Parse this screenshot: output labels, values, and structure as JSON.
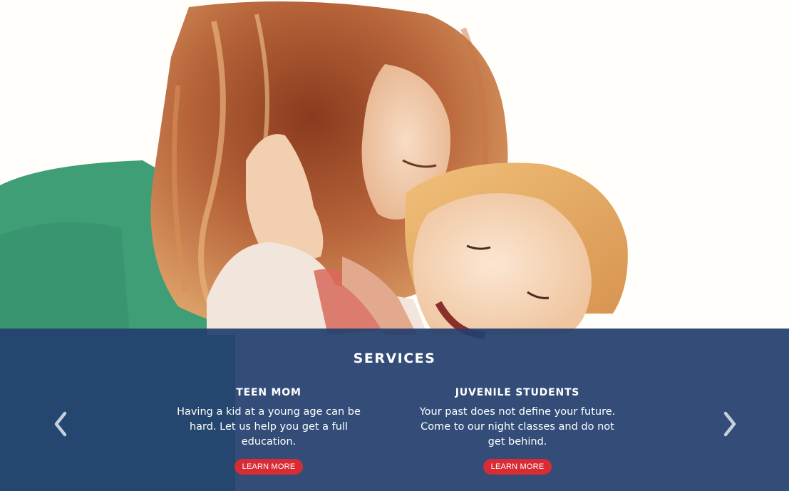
{
  "services": {
    "title": "SERVICES",
    "items": [
      {
        "title": "TEEN MOM",
        "text": "Having a kid at a young age can be hard. Let us help you get a full education.",
        "button": "LEARN MORE"
      },
      {
        "title": "JUVENILE STUDENTS",
        "text": "Your past does not define your future. Come to our night classes and do not get behind.",
        "button": "LEARN MORE"
      }
    ]
  },
  "colors": {
    "band": "#24406e",
    "button": "#d92b34",
    "arrow": "#c8cfdc"
  },
  "icons": {
    "prev": "chevron-left-icon",
    "next": "chevron-right-icon"
  }
}
